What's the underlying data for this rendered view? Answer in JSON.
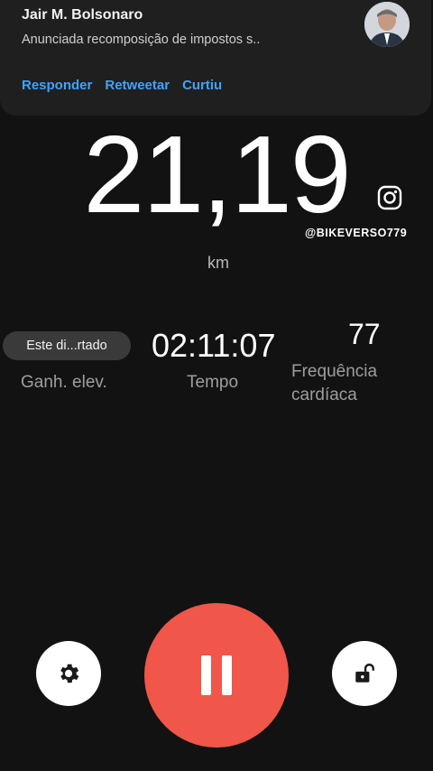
{
  "notification": {
    "sender": "Jair M. Bolsonaro",
    "body": "Anunciada recomposição de impostos s..",
    "actions": [
      "Responder",
      "Retweetar",
      "Curtiu"
    ]
  },
  "workout": {
    "distance": "21,19",
    "distance_unit": "km",
    "watermark_handle": "@BIKEVERSO779",
    "elevation_pill": "Este di...rtado",
    "elevation_label": "Ganh. elev.",
    "time_value": "02:11:07",
    "time_label": "Tempo",
    "heart_rate_value": "77",
    "heart_rate_label_line1": "Frequência",
    "heart_rate_label_line2": "cardíaca"
  },
  "controls": {
    "settings": "gear-icon",
    "pause": "pause-icon",
    "lock": "unlock-icon",
    "pause_color": "#f0564a"
  }
}
